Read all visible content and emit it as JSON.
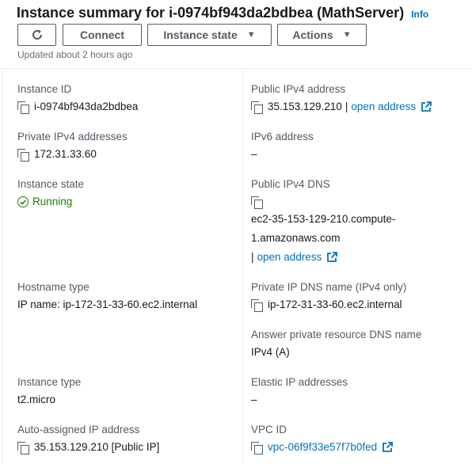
{
  "header": {
    "title": "Instance summary for i-0974bf943da2bdbea (MathServer)",
    "info_label": "Info",
    "refresh_icon": "refresh-icon",
    "buttons": {
      "connect": "Connect",
      "instance_state": "Instance state",
      "actions": "Actions"
    },
    "updated": "Updated about 2 hours ago"
  },
  "fields": {
    "instance_id": {
      "label": "Instance ID",
      "value": "i-0974bf943da2bdbea"
    },
    "public_ipv4": {
      "label": "Public IPv4 address",
      "value": "35.153.129.210",
      "separator": "|",
      "link": "open address"
    },
    "private_ipv4": {
      "label": "Private IPv4 addresses",
      "value": "172.31.33.60"
    },
    "ipv6": {
      "label": "IPv6 address",
      "value": "–"
    },
    "instance_state": {
      "label": "Instance state",
      "value": "Running",
      "status_color": "#1d8102"
    },
    "public_dns": {
      "label": "Public IPv4 DNS",
      "value_line1": "ec2-35-153-129-210.compute-",
      "value_line2": "1.amazonaws.com",
      "separator": "|",
      "link": "open address"
    },
    "hostname_type": {
      "label": "Hostname type",
      "value": "IP name: ip-172-31-33-60.ec2.internal"
    },
    "private_dns": {
      "label": "Private IP DNS name (IPv4 only)",
      "value": "ip-172-31-33-60.ec2.internal"
    },
    "answer_dns": {
      "label": "Answer private resource DNS name",
      "value": "IPv4 (A)"
    },
    "instance_type": {
      "label": "Instance type",
      "value": "t2.micro"
    },
    "elastic_ip": {
      "label": "Elastic IP addresses",
      "value": "–"
    },
    "auto_ip": {
      "label": "Auto-assigned IP address",
      "value": "35.153.129.210 [Public IP]"
    },
    "vpc_id": {
      "label": "VPC ID",
      "value": "vpc-06f9f33e57f7b0fed"
    }
  },
  "colors": {
    "link": "#0073bb",
    "text": "#16191f",
    "label": "#545b64",
    "success": "#1d8102"
  }
}
